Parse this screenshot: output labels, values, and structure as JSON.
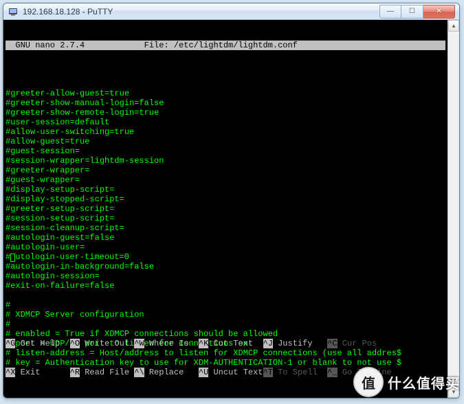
{
  "window": {
    "title": "192.168.18.128 - PuTTY",
    "min_icon": "—",
    "max_icon": "☐",
    "close_icon": "✕"
  },
  "nano": {
    "app": "  GNU nano 2.7.4",
    "file_label": "File: /etc/lightdm/lightdm.conf"
  },
  "content_before_cursor": "#greeter-allow-guest=true\n#greeter-show-manual-login=false\n#greeter-show-remote-login=true\n#user-session=default\n#allow-user-switching=true\n#allow-guest=true\n#guest-session=\n#session-wrapper=lightdm-session\n#greeter-wrapper=\n#guest-wrapper=\n#display-setup-script=\n#display-stopped-script=\n#greeter-setup-script=\n#session-setup-script=\n#session-cleanup-script=\n#autologin-guest=false\n#autologin-user=",
  "cursor_line_prefix": "#",
  "cursor_line_suffix": "utologin-user-timeout=0",
  "content_after_cursor": "#autologin-in-background=false\n#autologin-session=\n#exit-on-failure=false\n\n#\n# XDMCP Server configuration\n#\n# enabled = True if XDMCP connections should be allowed\n# port = UDP/IP port to listen for connections on\n# listen-address = Host/address to listen for XDMCP connections (use all addres$\n# key = Authentication key to use for XDM-AUTHENTICATION-1 or blank to not use $",
  "help": {
    "row1": [
      {
        "key": "^G",
        "label": " Get Help  "
      },
      {
        "key": "^O",
        "label": " Write Out "
      },
      {
        "key": "^W",
        "label": " Where Is  "
      },
      {
        "key": "^K",
        "label": " Cut Text  "
      },
      {
        "key": "^J",
        "label": " Justify   "
      },
      {
        "key": "^C",
        "label": " Cur Pos   "
      }
    ],
    "row2": [
      {
        "key": "^X",
        "label": " Exit      "
      },
      {
        "key": "^R",
        "label": " Read File "
      },
      {
        "key": "^\\",
        "label": " Replace   "
      },
      {
        "key": "^U",
        "label": " Uncut Text"
      },
      {
        "key": "^T",
        "label": " To Spell  "
      },
      {
        "key": "^_",
        "label": " Go To Line"
      }
    ]
  },
  "watermark": {
    "circle": "值",
    "text": "什么值得买"
  }
}
